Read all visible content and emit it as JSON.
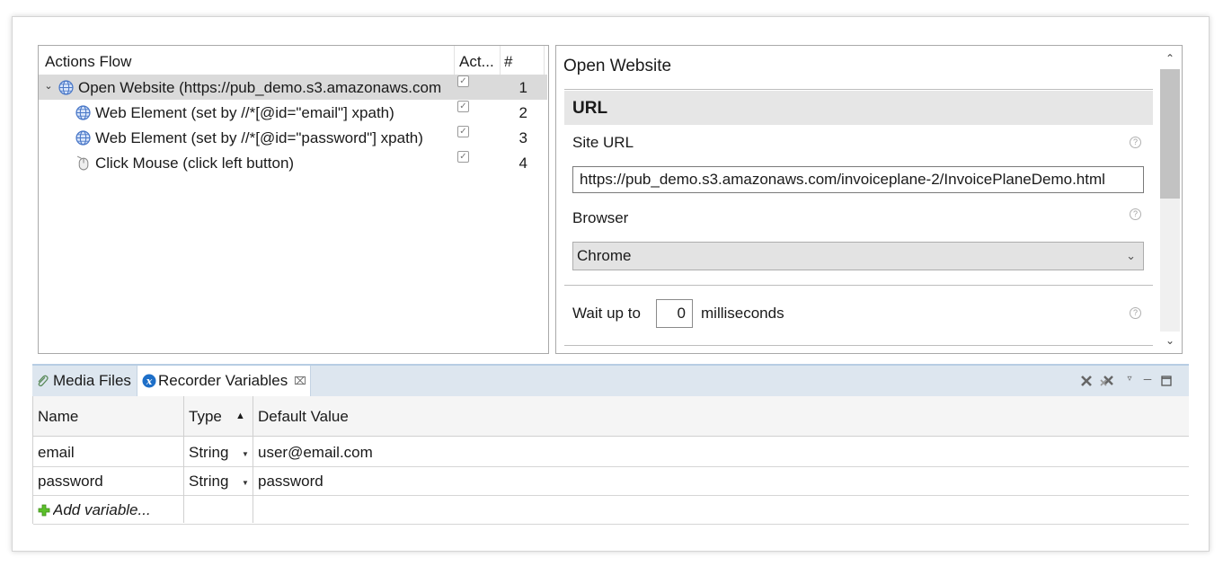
{
  "actions_flow": {
    "columns": {
      "name": "Actions Flow",
      "active": "Act...",
      "number": "#"
    },
    "items": [
      {
        "label": "Open Website (https://pub_demo.s3.amazonaws.com",
        "number": "1",
        "icon": "globe-icon",
        "checked": true,
        "selected": true,
        "expanded": true
      },
      {
        "label": "Web Element (set by //*[@id=\"email\"] xpath)",
        "number": "2",
        "icon": "globe-icon",
        "checked": true
      },
      {
        "label": "Web Element (set by //*[@id=\"password\"] xpath)",
        "number": "3",
        "icon": "globe-icon",
        "checked": true
      },
      {
        "label": "Click Mouse (click left button)",
        "number": "4",
        "icon": "mouse-icon",
        "checked": true
      }
    ]
  },
  "properties": {
    "title": "Open Website",
    "section_title": "URL",
    "site_url_label": "Site URL",
    "site_url_value": "https://pub_demo.s3.amazonaws.com/invoiceplane-2/InvoicePlaneDemo.html",
    "browser_label": "Browser",
    "browser_value": "Chrome",
    "wait_prefix": "Wait up to",
    "wait_value": "0",
    "wait_suffix": "milliseconds",
    "help_glyph": "?"
  },
  "bottom_view": {
    "tabs": [
      {
        "label": "Media Files",
        "icon": "paperclip-icon",
        "active": false
      },
      {
        "label": "Recorder Variables",
        "icon": "variable-x-icon",
        "active": true
      }
    ],
    "tools": [
      "remove-icon",
      "remove-all-icon",
      "view-menu-icon",
      "minimize-icon",
      "maximize-icon"
    ],
    "table": {
      "headers": {
        "name": "Name",
        "type": "Type",
        "default_value": "Default Value"
      },
      "rows": [
        {
          "name": "email",
          "type": "String",
          "default_value": "user@email.com"
        },
        {
          "name": "password",
          "type": "String",
          "default_value": "password"
        }
      ],
      "add_label": "Add variable..."
    }
  },
  "colors": {
    "selection": "#dadada",
    "tab_bar": "#dde6ef",
    "section_header": "#e6e6e6",
    "add_icon": "#4caf1e",
    "globe_icon": "#4a78c8"
  }
}
